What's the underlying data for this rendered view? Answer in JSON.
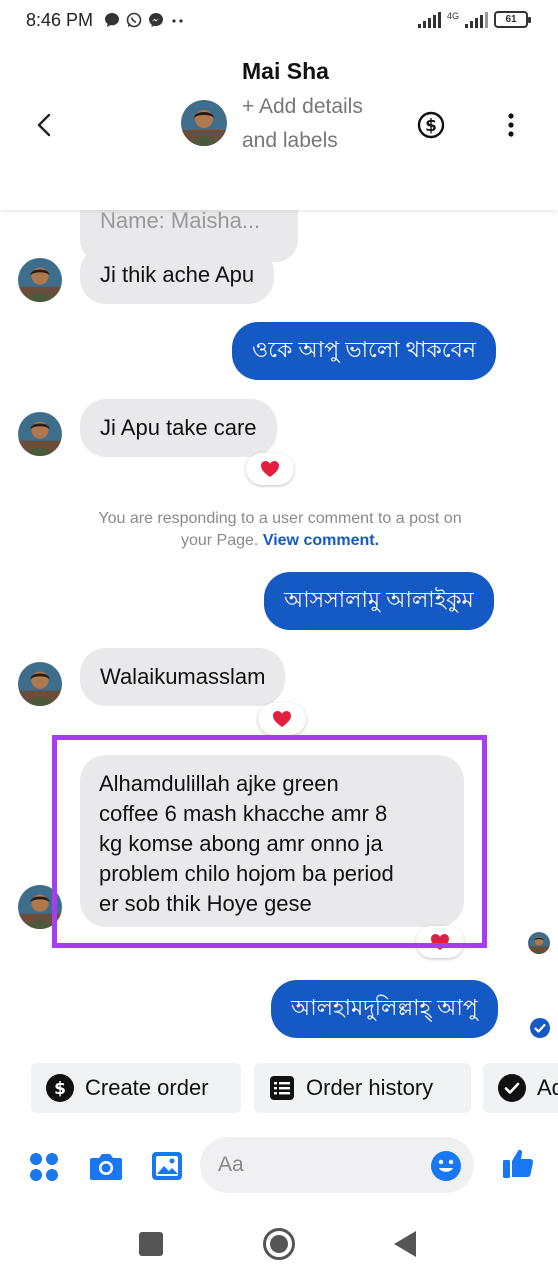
{
  "status_bar": {
    "time": "8:46 PM",
    "network": "4G",
    "battery": "61"
  },
  "header": {
    "contact_name": "Mai Sha",
    "add_details_label": "+ Add details and labels"
  },
  "messages": {
    "name_preview": "Name: Maisha...",
    "in_1": "Ji thik ache Apu",
    "out_1": "ওকে আপু ভালো থাকবেন",
    "in_2": "Ji Apu take care",
    "notice_text": "You are responding to a user comment to a post on your Page.",
    "notice_link": "View comment.",
    "out_2": "আসসালামু আলাইকুম",
    "in_3": "Walaikumasslam",
    "in_4_lines": [
      "Alhamdulillah ajke green",
      "coffee 6 mash khacche amr 8",
      "kg komse abong amr onno ja",
      "problem chilo hojom ba period",
      "er sob thik Hoye gese"
    ],
    "out_3": "আলহামদুলিল্লাহ্ আপু"
  },
  "quick_actions": {
    "create_order": "Create order",
    "order_history": "Order history",
    "third_partial": "Ad"
  },
  "composer": {
    "placeholder": "Aa"
  },
  "colors": {
    "accent_blue": "#1559c4",
    "highlight_purple": "#a63df0",
    "incoming_bubble": "#e9e9eb",
    "heart_red": "#e41e3f"
  }
}
